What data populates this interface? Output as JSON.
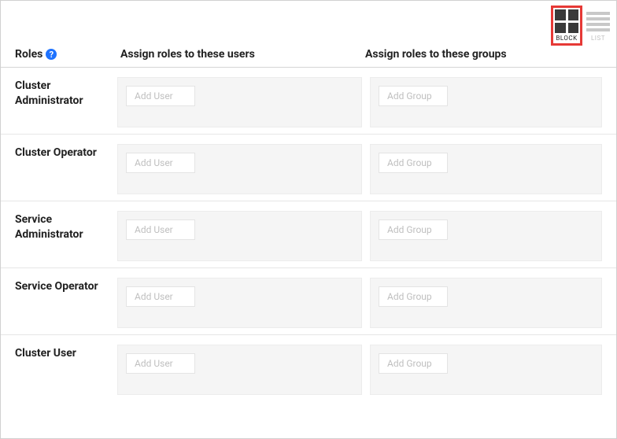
{
  "viewToggle": {
    "blockLabel": "BLOCK",
    "listLabel": "LIST"
  },
  "header": {
    "rolesLabel": "Roles",
    "usersLabel": "Assign roles to these users",
    "groupsLabel": "Assign roles to these groups"
  },
  "placeholders": {
    "addUser": "Add User",
    "addGroup": "Add Group"
  },
  "roles": [
    {
      "name": "Cluster Administrator"
    },
    {
      "name": "Cluster Operator"
    },
    {
      "name": "Service Administrator"
    },
    {
      "name": "Service Operator"
    },
    {
      "name": "Cluster User"
    }
  ]
}
